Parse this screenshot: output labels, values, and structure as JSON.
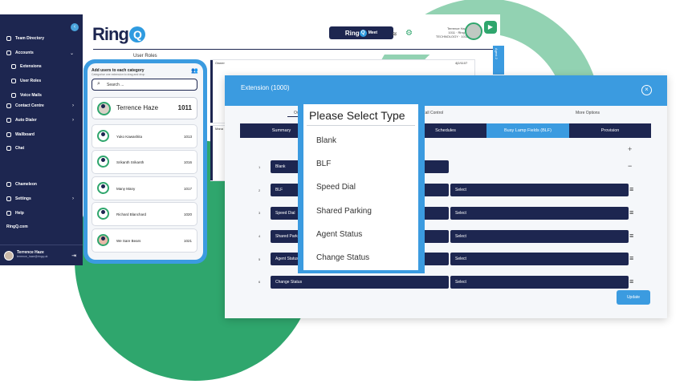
{
  "sidebar": {
    "items": [
      {
        "label": "Team Directory",
        "icon": "team-directory-icon"
      },
      {
        "label": "Accounts",
        "icon": "accounts-icon",
        "chevron": "⌄"
      },
      {
        "label": "Extensions",
        "icon": "extensions-icon"
      },
      {
        "label": "User Roles",
        "icon": "user-roles-icon"
      },
      {
        "label": "Voice Mails",
        "icon": "voicemail-icon"
      },
      {
        "label": "Contact Centre",
        "icon": "contact-centre-icon",
        "chevron": "›"
      },
      {
        "label": "Auto Dialer",
        "icon": "auto-dialer-icon",
        "chevron": "›"
      },
      {
        "label": "Wallboard",
        "icon": "wallboard-icon"
      },
      {
        "label": "Chat",
        "icon": "chat-icon"
      },
      {
        "label": "Chameleon",
        "icon": "chameleon-icon"
      },
      {
        "label": "Settings",
        "icon": "settings-icon",
        "chevron": "›"
      },
      {
        "label": "Help",
        "icon": "help-icon"
      },
      {
        "label": "RingQ.com",
        "icon": ""
      }
    ],
    "user": {
      "name": "Terrence Haze",
      "sub": "terrence_haze@ringq.uk"
    }
  },
  "header": {
    "logo": "Ring",
    "logo_q": "Q",
    "meet_label": "Ring",
    "meet_q": "Q",
    "meet_suffix": "Meet",
    "user_lines": [
      "Terrence Haze",
      "1011 · Ring Q",
      "TECHNOLOGY · 1011"
    ]
  },
  "page_heading": "User Roles",
  "user_panel": {
    "title": "Add users to each category",
    "subtitle": "Categorise one extension to drag and drop",
    "search_placeholder": "Search ...",
    "users": [
      {
        "name": "Terrence Haze",
        "ext": "1011"
      },
      {
        "name": "Yuko Kawashita",
        "ext": "1013"
      },
      {
        "name": "Srikanth Srikanth",
        "ext": "1016"
      },
      {
        "name": "Many Many",
        "ext": "1017"
      },
      {
        "name": "Richard Blanchard",
        "ext": "1020"
      },
      {
        "name": "We Sare Bears",
        "ext": "1021"
      }
    ]
  },
  "mini_columns": {
    "owner_label": "Owner",
    "owner_count": "4|2/1107",
    "manager_label": "Mana",
    "right_strip": "Agent 2"
  },
  "modal": {
    "title": "Extension (1000)",
    "top_tabs": [
      "Ov",
      "Call Control",
      "More Options"
    ],
    "sub_tabs": [
      "Summary",
      "",
      "Schedules",
      "Busy Lamp Fields (BLF)",
      "Provision"
    ],
    "rows": [
      {
        "num": "1",
        "type": "Blank",
        "select": ""
      },
      {
        "num": "2",
        "type": "BLF",
        "select": "Select"
      },
      {
        "num": "3",
        "type": "Speed Dial",
        "select": "Select"
      },
      {
        "num": "4",
        "type": "Shared Park",
        "select": "Select"
      },
      {
        "num": "5",
        "type": "Agent Status",
        "select": "Select"
      },
      {
        "num": "6",
        "type": "Change Status",
        "select": "Select"
      }
    ],
    "update_label": "Update"
  },
  "dropdown": {
    "title": "Please Select Type",
    "options": [
      "Blank",
      "BLF",
      "Speed Dial",
      "Shared Parking",
      "Agent Status",
      "Change Status"
    ]
  },
  "colors": {
    "navy": "#1d2650",
    "blue": "#3b9be0",
    "green": "#2fa66d",
    "light_green": "#7fcaa5"
  }
}
